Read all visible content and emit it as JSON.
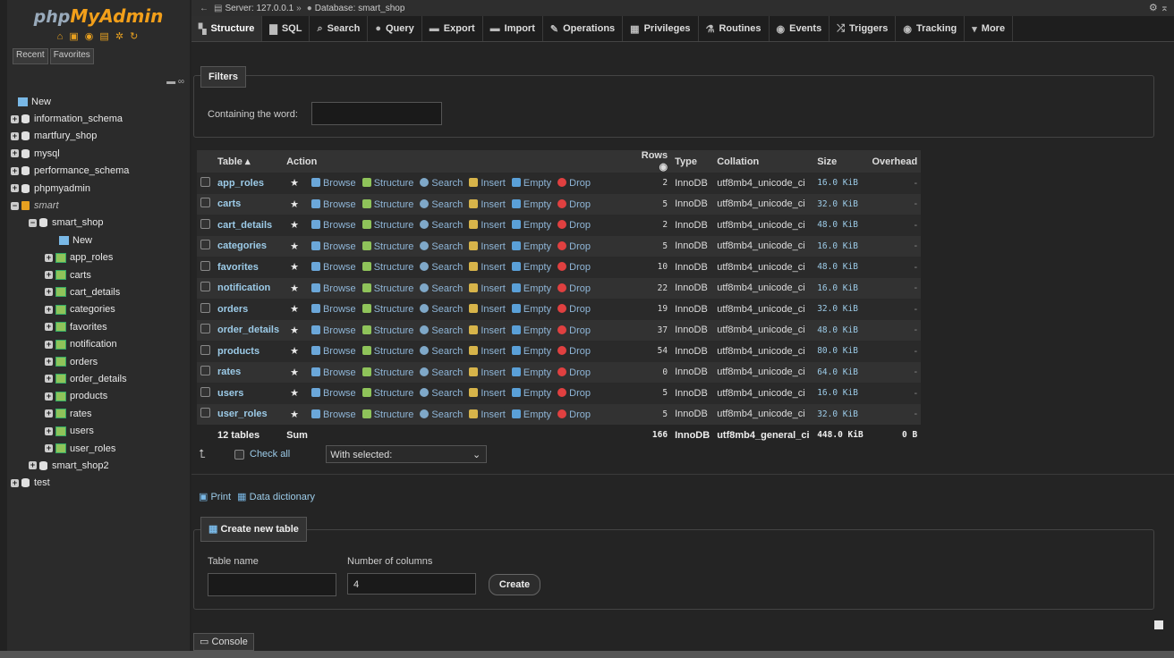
{
  "app": {
    "logo_part1": "php",
    "logo_part2": "MyAdmin",
    "quick_icons": "⌂ ▣ ◉ ▤ ✲ ↻"
  },
  "sidebar": {
    "recent_label": "Recent",
    "favorites_label": "Favorites",
    "tree": [
      {
        "label": "New",
        "level": 0,
        "kind": "new"
      },
      {
        "label": "information_schema",
        "level": 0,
        "kind": "db"
      },
      {
        "label": "martfury_shop",
        "level": 0,
        "kind": "db"
      },
      {
        "label": "mysql",
        "level": 0,
        "kind": "db"
      },
      {
        "label": "performance_schema",
        "level": 0,
        "kind": "db"
      },
      {
        "label": "phpmyadmin",
        "level": 0,
        "kind": "db"
      },
      {
        "label": "smart",
        "level": 0,
        "kind": "group"
      },
      {
        "label": "smart_shop",
        "level": 1,
        "kind": "db-open"
      },
      {
        "label": "New",
        "level": 2,
        "kind": "new"
      },
      {
        "label": "app_roles",
        "level": 2,
        "kind": "table"
      },
      {
        "label": "carts",
        "level": 2,
        "kind": "table"
      },
      {
        "label": "cart_details",
        "level": 2,
        "kind": "table"
      },
      {
        "label": "categories",
        "level": 2,
        "kind": "table"
      },
      {
        "label": "favorites",
        "level": 2,
        "kind": "table"
      },
      {
        "label": "notification",
        "level": 2,
        "kind": "table"
      },
      {
        "label": "orders",
        "level": 2,
        "kind": "table"
      },
      {
        "label": "order_details",
        "level": 2,
        "kind": "table"
      },
      {
        "label": "products",
        "level": 2,
        "kind": "table"
      },
      {
        "label": "rates",
        "level": 2,
        "kind": "table"
      },
      {
        "label": "users",
        "level": 2,
        "kind": "table"
      },
      {
        "label": "user_roles",
        "level": 2,
        "kind": "table"
      },
      {
        "label": "smart_shop2",
        "level": 1,
        "kind": "db"
      },
      {
        "label": "test",
        "level": 0,
        "kind": "db"
      }
    ]
  },
  "breadcrumb": {
    "server": "Server: 127.0.0.1",
    "separator": "»",
    "database": "Database: smart_shop"
  },
  "tabs": [
    "Structure",
    "SQL",
    "Search",
    "Query",
    "Export",
    "Import",
    "Operations",
    "Privileges",
    "Routines",
    "Events",
    "Triggers",
    "Tracking",
    "More"
  ],
  "filters": {
    "title": "Filters",
    "label": "Containing the word:",
    "value": ""
  },
  "table_headers": {
    "table": "Table",
    "action": "Action",
    "rows": "Rows",
    "type": "Type",
    "collation": "Collation",
    "size": "Size",
    "overhead": "Overhead"
  },
  "actions": {
    "browse": "Browse",
    "structure": "Structure",
    "search": "Search",
    "insert": "Insert",
    "empty": "Empty",
    "drop": "Drop"
  },
  "tables": [
    {
      "name": "app_roles",
      "rows": "2",
      "type": "InnoDB",
      "collation": "utf8mb4_unicode_ci",
      "size": "16.0 KiB",
      "overhead": "-"
    },
    {
      "name": "carts",
      "rows": "5",
      "type": "InnoDB",
      "collation": "utf8mb4_unicode_ci",
      "size": "32.0 KiB",
      "overhead": "-"
    },
    {
      "name": "cart_details",
      "rows": "2",
      "type": "InnoDB",
      "collation": "utf8mb4_unicode_ci",
      "size": "48.0 KiB",
      "overhead": "-"
    },
    {
      "name": "categories",
      "rows": "5",
      "type": "InnoDB",
      "collation": "utf8mb4_unicode_ci",
      "size": "16.0 KiB",
      "overhead": "-"
    },
    {
      "name": "favorites",
      "rows": "10",
      "type": "InnoDB",
      "collation": "utf8mb4_unicode_ci",
      "size": "48.0 KiB",
      "overhead": "-"
    },
    {
      "name": "notification",
      "rows": "22",
      "type": "InnoDB",
      "collation": "utf8mb4_unicode_ci",
      "size": "16.0 KiB",
      "overhead": "-"
    },
    {
      "name": "orders",
      "rows": "19",
      "type": "InnoDB",
      "collation": "utf8mb4_unicode_ci",
      "size": "32.0 KiB",
      "overhead": "-"
    },
    {
      "name": "order_details",
      "rows": "37",
      "type": "InnoDB",
      "collation": "utf8mb4_unicode_ci",
      "size": "48.0 KiB",
      "overhead": "-"
    },
    {
      "name": "products",
      "rows": "54",
      "type": "InnoDB",
      "collation": "utf8mb4_unicode_ci",
      "size": "80.0 KiB",
      "overhead": "-"
    },
    {
      "name": "rates",
      "rows": "0",
      "type": "InnoDB",
      "collation": "utf8mb4_unicode_ci",
      "size": "64.0 KiB",
      "overhead": "-"
    },
    {
      "name": "users",
      "rows": "5",
      "type": "InnoDB",
      "collation": "utf8mb4_unicode_ci",
      "size": "16.0 KiB",
      "overhead": "-"
    },
    {
      "name": "user_roles",
      "rows": "5",
      "type": "InnoDB",
      "collation": "utf8mb4_unicode_ci",
      "size": "32.0 KiB",
      "overhead": "-"
    }
  ],
  "summary": {
    "count": "12 tables",
    "label": "Sum",
    "rows": "166",
    "type": "InnoDB",
    "collation": "utf8mb4_general_ci",
    "size": "448.0 KiB",
    "overhead": "0 B"
  },
  "bulk": {
    "check_all": "Check all",
    "with_selected": "With selected:"
  },
  "links": {
    "print": "Print",
    "data_dictionary": "Data dictionary"
  },
  "create_table": {
    "title": "Create new table",
    "name_label": "Table name",
    "name_value": "",
    "columns_label": "Number of columns",
    "columns_value": "4",
    "button": "Create"
  },
  "console": {
    "label": "Console"
  },
  "colors": {
    "accent": "#9ccbe8",
    "logo_orange": "#f29f1a",
    "drop_red": "#e04040"
  }
}
